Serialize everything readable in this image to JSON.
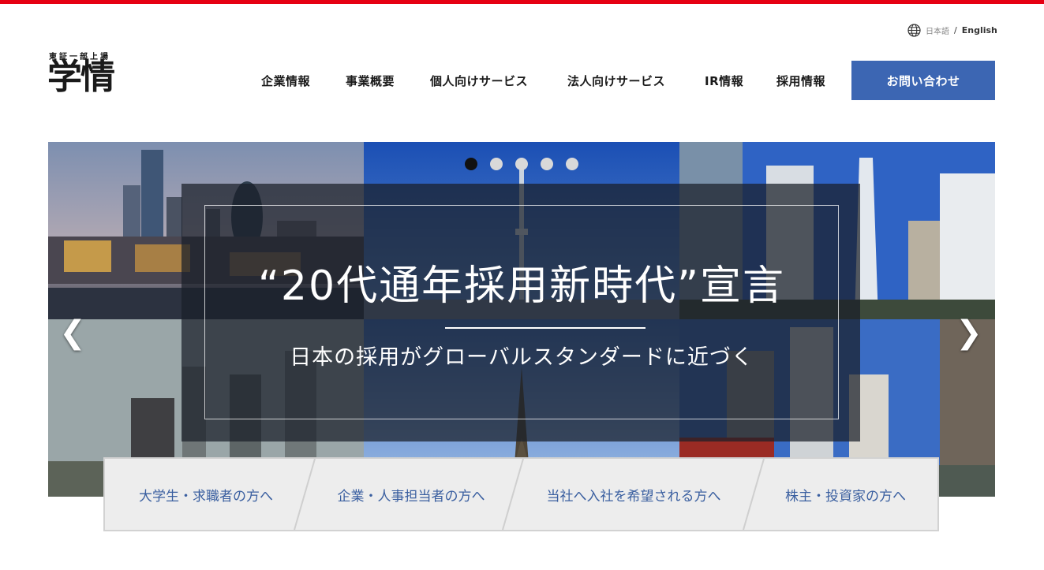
{
  "colors": {
    "top_bar": "#e60012",
    "contact_button": "#3c66b3",
    "audience_text": "#3a5fa0",
    "audience_bg": "#ededed"
  },
  "language": {
    "icon": "globe-icon",
    "japanese": "日本語",
    "separator": "/",
    "english": "English"
  },
  "logo": {
    "tagline": "東証一部上場",
    "mark": "学情"
  },
  "nav": {
    "items": [
      "企業情報",
      "事業概要",
      "個人向けサービス",
      "法人向けサービス",
      "IR情報",
      "採用情報"
    ],
    "contact": "お問い合わせ"
  },
  "hero": {
    "headline": "“20代通年採用新時代”宣言",
    "subline": "日本の採用がグローバルスタンダードに近づく",
    "slide_count": 5,
    "active_slide": 1,
    "prev_icon": "chevron-left-icon",
    "next_icon": "chevron-right-icon",
    "prev_glyph": "❮",
    "next_glyph": "❯"
  },
  "audience": {
    "items": [
      "大学生・求職者の方へ",
      "企業・人事担当者の方へ",
      "当社へ入社を希望される方へ",
      "株主・投資家の方へ"
    ]
  }
}
